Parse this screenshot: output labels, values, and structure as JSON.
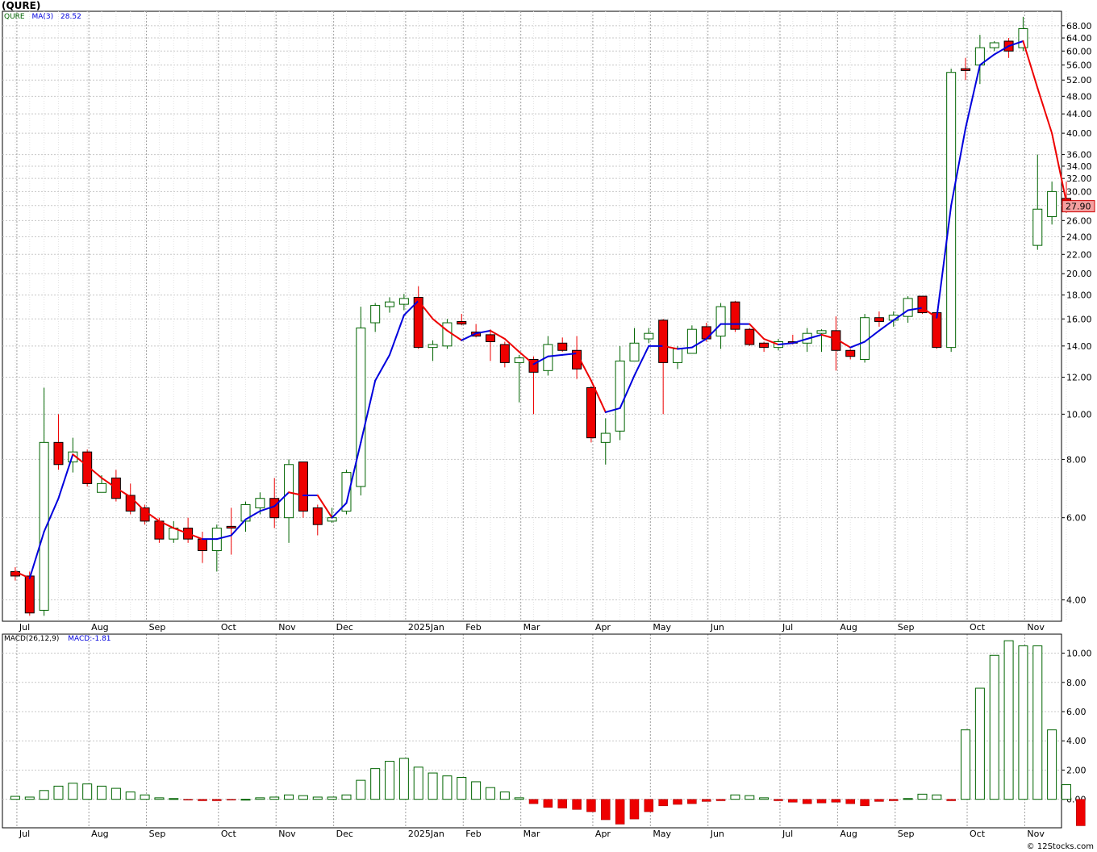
{
  "title": "(QURE)",
  "price_legend": {
    "symbol": "QURE",
    "ma_label": "MA(3)",
    "ma_value": "28.52"
  },
  "macd_legend": {
    "label": "MACD(26,12,9)",
    "value_label": "MACD:",
    "value": "-1.81"
  },
  "last_price_label": "27.90",
  "footer": "© 12Stocks.com",
  "colors": {
    "up": "#ffffff",
    "up_border": "#006400",
    "down": "#ee0000",
    "ma_up": "#0000dd",
    "ma_down": "#ee0000",
    "grid": "#c8c8c8",
    "macd_pos": "#006400",
    "macd_neg": "#ee0000"
  },
  "chart_data": [
    {
      "type": "candlestick",
      "title": "(QURE)",
      "scale": "log",
      "y_ticks": [
        4,
        6,
        8,
        10,
        12,
        14,
        16,
        18,
        20,
        22,
        24,
        26,
        28,
        30,
        32,
        34,
        36,
        40,
        44,
        48,
        52,
        56,
        60,
        64,
        68
      ],
      "y_tick_labels": [
        "4.00",
        "6.00",
        "8.00",
        "10.00",
        "12.00",
        "14.00",
        "16.00",
        "18.00",
        "20.00",
        "22.00",
        "24.00",
        "26.00",
        "28.00",
        "30.00",
        "32.00",
        "34.00",
        "36.00",
        "40.00",
        "44.00",
        "48.00",
        "52.00",
        "56.00",
        "60.00",
        "64.00",
        "68.00"
      ],
      "x_labels": [
        {
          "label": "Jul",
          "week": 1
        },
        {
          "label": "Aug",
          "week": 6
        },
        {
          "label": "Sep",
          "week": 10
        },
        {
          "label": "Oct",
          "week": 15
        },
        {
          "label": "Nov",
          "week": 19
        },
        {
          "label": "Dec",
          "week": 23
        },
        {
          "label": "2025Jan",
          "week": 28
        },
        {
          "label": "Feb",
          "week": 32
        },
        {
          "label": "Mar",
          "week": 36
        },
        {
          "label": "Apr",
          "week": 41
        },
        {
          "label": "May",
          "week": 45
        },
        {
          "label": "Jun",
          "week": 49
        },
        {
          "label": "Jul",
          "week": 54
        },
        {
          "label": "Aug",
          "week": 58
        },
        {
          "label": "Sep",
          "week": 62
        },
        {
          "label": "Oct",
          "week": 67
        },
        {
          "label": "Nov",
          "week": 71
        }
      ],
      "candles": [
        {
          "o": 4.6,
          "h": 4.7,
          "l": 4.4,
          "c": 4.5
        },
        {
          "o": 4.5,
          "h": 4.6,
          "l": 3.7,
          "c": 3.75
        },
        {
          "o": 3.8,
          "h": 11.4,
          "l": 3.7,
          "c": 8.7
        },
        {
          "o": 8.7,
          "h": 10.0,
          "l": 7.6,
          "c": 7.8
        },
        {
          "o": 7.9,
          "h": 8.9,
          "l": 7.5,
          "c": 8.3
        },
        {
          "o": 8.3,
          "h": 8.4,
          "l": 7.0,
          "c": 7.1
        },
        {
          "o": 6.8,
          "h": 7.4,
          "l": 6.8,
          "c": 7.1
        },
        {
          "o": 7.3,
          "h": 7.6,
          "l": 6.5,
          "c": 6.6
        },
        {
          "o": 6.7,
          "h": 7.1,
          "l": 6.1,
          "c": 6.2
        },
        {
          "o": 6.3,
          "h": 6.4,
          "l": 5.8,
          "c": 5.9
        },
        {
          "o": 5.9,
          "h": 6.0,
          "l": 5.3,
          "c": 5.4
        },
        {
          "o": 5.4,
          "h": 5.9,
          "l": 5.3,
          "c": 5.7
        },
        {
          "o": 5.7,
          "h": 6.0,
          "l": 5.3,
          "c": 5.4
        },
        {
          "o": 5.4,
          "h": 5.6,
          "l": 4.8,
          "c": 5.1
        },
        {
          "o": 5.1,
          "h": 5.8,
          "l": 4.6,
          "c": 5.7
        },
        {
          "o": 5.75,
          "h": 6.3,
          "l": 5.0,
          "c": 5.7
        },
        {
          "o": 5.9,
          "h": 6.5,
          "l": 5.6,
          "c": 6.4
        },
        {
          "o": 6.3,
          "h": 6.8,
          "l": 6.1,
          "c": 6.6
        },
        {
          "o": 6.6,
          "h": 7.3,
          "l": 5.7,
          "c": 6.0
        },
        {
          "o": 6.0,
          "h": 8.0,
          "l": 5.3,
          "c": 7.8
        },
        {
          "o": 7.9,
          "h": 7.9,
          "l": 6.0,
          "c": 6.2
        },
        {
          "o": 6.3,
          "h": 6.4,
          "l": 5.5,
          "c": 5.8
        },
        {
          "o": 5.9,
          "h": 6.3,
          "l": 5.85,
          "c": 6.0
        },
        {
          "o": 6.2,
          "h": 7.6,
          "l": 6.1,
          "c": 7.5
        },
        {
          "o": 7.0,
          "h": 17.0,
          "l": 6.7,
          "c": 15.3
        },
        {
          "o": 15.7,
          "h": 17.3,
          "l": 15.0,
          "c": 17.1
        },
        {
          "o": 17.0,
          "h": 17.8,
          "l": 16.5,
          "c": 17.4
        },
        {
          "o": 17.2,
          "h": 18.1,
          "l": 16.7,
          "c": 17.7
        },
        {
          "o": 17.8,
          "h": 18.8,
          "l": 13.8,
          "c": 13.9
        },
        {
          "o": 13.9,
          "h": 14.4,
          "l": 13.0,
          "c": 14.1
        },
        {
          "o": 14.0,
          "h": 16.0,
          "l": 13.8,
          "c": 15.7
        },
        {
          "o": 15.8,
          "h": 16.4,
          "l": 15.5,
          "c": 15.6
        },
        {
          "o": 15.0,
          "h": 15.6,
          "l": 14.6,
          "c": 14.7
        },
        {
          "o": 14.8,
          "h": 15.2,
          "l": 13.0,
          "c": 14.3
        },
        {
          "o": 14.1,
          "h": 14.3,
          "l": 12.6,
          "c": 12.9
        },
        {
          "o": 12.9,
          "h": 13.4,
          "l": 10.6,
          "c": 13.2
        },
        {
          "o": 13.1,
          "h": 13.3,
          "l": 10.0,
          "c": 12.3
        },
        {
          "o": 12.4,
          "h": 14.7,
          "l": 12.1,
          "c": 14.1
        },
        {
          "o": 14.2,
          "h": 14.6,
          "l": 13.6,
          "c": 13.7
        },
        {
          "o": 13.7,
          "h": 14.7,
          "l": 11.9,
          "c": 12.5
        },
        {
          "o": 11.4,
          "h": 11.5,
          "l": 8.7,
          "c": 8.9
        },
        {
          "o": 8.7,
          "h": 9.8,
          "l": 7.8,
          "c": 9.1
        },
        {
          "o": 9.2,
          "h": 14.0,
          "l": 8.8,
          "c": 13.0
        },
        {
          "o": 13.0,
          "h": 15.3,
          "l": 13.0,
          "c": 14.2
        },
        {
          "o": 14.5,
          "h": 15.3,
          "l": 14.2,
          "c": 14.9
        },
        {
          "o": 15.9,
          "h": 16.0,
          "l": 10.0,
          "c": 12.9
        },
        {
          "o": 12.9,
          "h": 14.0,
          "l": 12.5,
          "c": 13.8
        },
        {
          "o": 13.5,
          "h": 15.5,
          "l": 13.5,
          "c": 15.2
        },
        {
          "o": 15.4,
          "h": 15.7,
          "l": 14.3,
          "c": 14.5
        },
        {
          "o": 14.7,
          "h": 17.3,
          "l": 13.8,
          "c": 17.0
        },
        {
          "o": 17.4,
          "h": 17.5,
          "l": 15.0,
          "c": 15.2
        },
        {
          "o": 15.2,
          "h": 15.3,
          "l": 14.0,
          "c": 14.1
        },
        {
          "o": 14.2,
          "h": 14.3,
          "l": 13.6,
          "c": 13.9
        },
        {
          "o": 13.9,
          "h": 14.5,
          "l": 13.7,
          "c": 14.3
        },
        {
          "o": 14.3,
          "h": 14.8,
          "l": 14.1,
          "c": 14.2
        },
        {
          "o": 14.2,
          "h": 15.3,
          "l": 13.6,
          "c": 14.9
        },
        {
          "o": 14.9,
          "h": 15.2,
          "l": 13.6,
          "c": 15.1
        },
        {
          "o": 15.1,
          "h": 16.2,
          "l": 12.4,
          "c": 13.7
        },
        {
          "o": 13.7,
          "h": 13.8,
          "l": 13.1,
          "c": 13.3
        },
        {
          "o": 13.1,
          "h": 16.4,
          "l": 12.9,
          "c": 16.1
        },
        {
          "o": 16.1,
          "h": 16.6,
          "l": 15.4,
          "c": 15.8
        },
        {
          "o": 15.9,
          "h": 16.6,
          "l": 15.4,
          "c": 16.3
        },
        {
          "o": 16.2,
          "h": 17.9,
          "l": 15.7,
          "c": 17.7
        },
        {
          "o": 17.9,
          "h": 17.9,
          "l": 16.4,
          "c": 16.5
        },
        {
          "o": 16.5,
          "h": 16.5,
          "l": 13.8,
          "c": 13.9
        },
        {
          "o": 13.9,
          "h": 55.0,
          "l": 13.6,
          "c": 54.0
        },
        {
          "o": 55.0,
          "h": 58.0,
          "l": 52.0,
          "c": 54.5
        },
        {
          "o": 56.0,
          "h": 65.0,
          "l": 51.0,
          "c": 61.0
        },
        {
          "o": 61.0,
          "h": 63.0,
          "l": 60.0,
          "c": 62.5
        },
        {
          "o": 63.0,
          "h": 64.0,
          "l": 58.0,
          "c": 60.0
        },
        {
          "o": 61.0,
          "h": 71.0,
          "l": 60.0,
          "c": 67.0
        },
        {
          "o": 23.0,
          "h": 36.0,
          "l": 22.5,
          "c": 27.5
        },
        {
          "o": 26.5,
          "h": 31.5,
          "l": 25.5,
          "c": 30.0
        },
        {
          "o": 29.0,
          "h": 31.5,
          "l": 27.0,
          "c": 27.9
        }
      ],
      "ma3": [
        4.6,
        4.45,
        5.6,
        6.6,
        8.2,
        7.75,
        7.3,
        6.95,
        6.65,
        6.2,
        5.9,
        5.7,
        5.55,
        5.4,
        5.4,
        5.5,
        5.95,
        6.2,
        6.35,
        6.8,
        6.7,
        6.7,
        6.0,
        6.45,
        8.7,
        11.8,
        13.4,
        16.3,
        17.5,
        16.0,
        15.1,
        14.4,
        14.9,
        15.1,
        14.5,
        13.6,
        12.8,
        13.3,
        13.4,
        13.5,
        11.8,
        10.1,
        10.3,
        12.1,
        14.0,
        14.0,
        13.8,
        13.9,
        14.5,
        15.6,
        15.6,
        15.6,
        14.5,
        14.1,
        14.2,
        14.5,
        14.8,
        14.5,
        13.9,
        14.3,
        15.1,
        15.9,
        16.7,
        16.9,
        16.1,
        28.0,
        41.0,
        56.0,
        59.0,
        61.5,
        63.0,
        50.0,
        40.0,
        28.5
      ],
      "last_price": 27.9
    },
    {
      "type": "bar",
      "title": "MACD(26,12,9)",
      "y_ticks": [
        0,
        2,
        4,
        6,
        8,
        10
      ],
      "y_tick_labels": [
        "0.00",
        "2.00",
        "4.00",
        "6.00",
        "8.00",
        "10.00"
      ],
      "values": [
        0.2,
        0.15,
        0.6,
        0.9,
        1.1,
        1.05,
        0.9,
        0.75,
        0.5,
        0.3,
        0.1,
        0.05,
        -0.05,
        -0.1,
        -0.1,
        -0.05,
        0.0,
        0.1,
        0.15,
        0.3,
        0.25,
        0.15,
        0.15,
        0.3,
        1.3,
        2.1,
        2.6,
        2.8,
        2.2,
        1.8,
        1.6,
        1.5,
        1.2,
        0.8,
        0.5,
        0.1,
        -0.3,
        -0.55,
        -0.6,
        -0.7,
        -0.85,
        -1.4,
        -1.7,
        -1.35,
        -0.85,
        -0.45,
        -0.35,
        -0.3,
        -0.15,
        -0.1,
        0.3,
        0.25,
        0.1,
        -0.1,
        -0.2,
        -0.3,
        -0.25,
        -0.2,
        -0.3,
        -0.45,
        -0.15,
        -0.1,
        0.05,
        0.35,
        0.3,
        -0.1,
        4.75,
        7.6,
        9.85,
        10.85,
        10.5,
        10.5,
        4.75,
        1.0,
        -1.81
      ],
      "last_value": -1.81
    }
  ]
}
